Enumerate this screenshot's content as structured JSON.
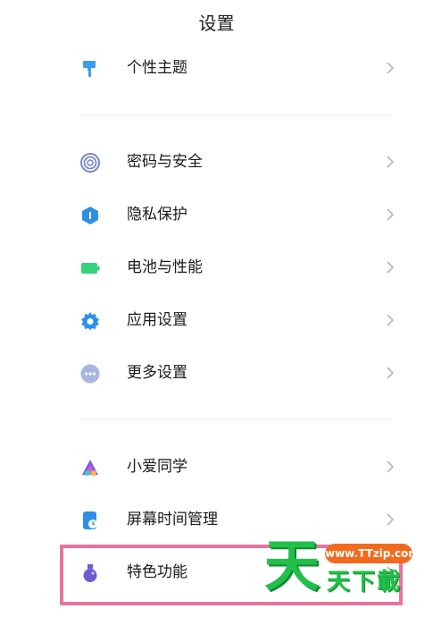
{
  "header": {
    "title": "设置"
  },
  "groups": [
    {
      "items": [
        {
          "label": "个性主题",
          "icon": "brush-icon",
          "color": "#3d9cf0"
        }
      ]
    },
    {
      "items": [
        {
          "label": "密码与安全",
          "icon": "fingerprint-icon",
          "color": "#7b86c9"
        },
        {
          "label": "隐私保护",
          "icon": "privacy-shield-icon",
          "color": "#2f8fe8"
        },
        {
          "label": "电池与性能",
          "icon": "battery-icon",
          "color": "#33d47a"
        },
        {
          "label": "应用设置",
          "icon": "gear-icon",
          "color": "#2e90f0"
        },
        {
          "label": "更多设置",
          "icon": "more-dots-icon",
          "color": "#a8b4e2"
        }
      ]
    },
    {
      "items": [
        {
          "label": "小爱同学",
          "icon": "xiaoai-icon",
          "color": "#7b5cf5"
        },
        {
          "label": "屏幕时间管理",
          "icon": "screen-time-icon",
          "color": "#2f8fe8"
        },
        {
          "label": "特色功能",
          "icon": "flask-icon",
          "color": "#6f5ad6"
        }
      ]
    }
  ],
  "highlight_color": "#e8739d",
  "watermark": {
    "big": "天",
    "url": "www.TTzip.com",
    "sub": "天下載"
  }
}
